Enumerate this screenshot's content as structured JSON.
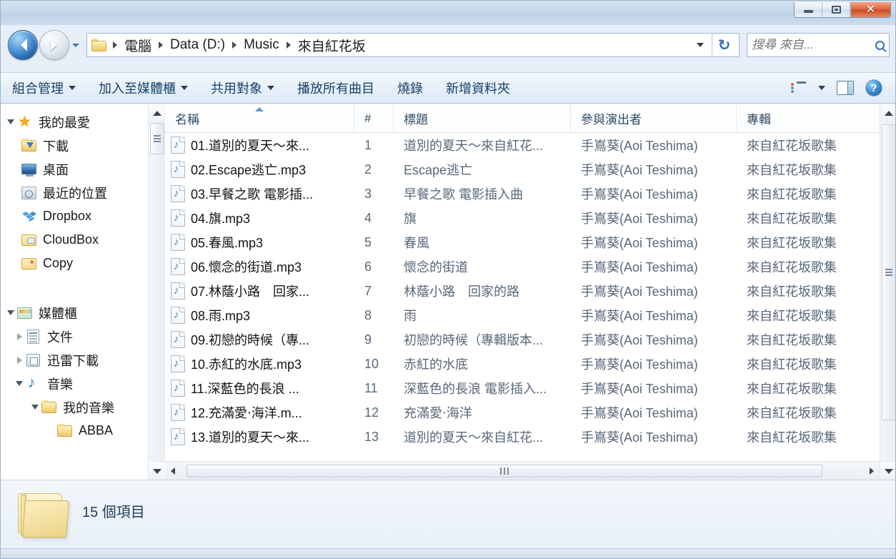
{
  "window": {
    "buttons": {
      "minimize": "minimize",
      "restore": "restore",
      "close": "✕"
    }
  },
  "address": {
    "back_label": "上一頁",
    "forward_label": "下一頁",
    "history_label": "最近的位置",
    "crumbs": [
      "電腦",
      "Data (D:)",
      "Music",
      "來自紅花坂"
    ],
    "dropdown_label": "▼",
    "refresh_label": "重新整理",
    "refresh_glyph": "↻"
  },
  "search": {
    "placeholder": "搜尋 來自...",
    "value": "",
    "icon": "search-icon"
  },
  "toolbar": {
    "items": [
      {
        "label": "組合管理",
        "caret": true
      },
      {
        "label": "加入至媒體櫃",
        "caret": true
      },
      {
        "label": "共用對象",
        "caret": true
      },
      {
        "label": "播放所有曲目",
        "caret": false
      },
      {
        "label": "燒錄",
        "caret": false
      },
      {
        "label": "新增資料夾",
        "caret": false
      }
    ],
    "view_options_icon": "view-list-icon",
    "view_caret": "▼",
    "preview_pane_icon": "preview-pane-icon",
    "help_icon": "help-icon",
    "help_glyph": "?"
  },
  "sidebar": {
    "groups": [
      {
        "label": "我的最愛",
        "icon": "star-icon",
        "expander": "open",
        "items": [
          {
            "label": "下載",
            "icon": "folder-download-icon"
          },
          {
            "label": "桌面",
            "icon": "desktop-icon"
          },
          {
            "label": "最近的位置",
            "icon": "recent-places-icon"
          },
          {
            "label": "Dropbox",
            "icon": "dropbox-icon"
          },
          {
            "label": "CloudBox",
            "icon": "cloudbox-folder-icon"
          },
          {
            "label": "Copy",
            "icon": "copy-folder-icon"
          }
        ]
      },
      {
        "label": "媒體櫃",
        "icon": "library-icon",
        "expander": "open",
        "items": [
          {
            "label": "文件",
            "icon": "documents-icon",
            "expander": "closed",
            "indent": 1
          },
          {
            "label": "迅雷下載",
            "icon": "thunder-download-icon",
            "expander": "closed",
            "indent": 1
          },
          {
            "label": "音樂",
            "icon": "music-note-icon",
            "expander": "open",
            "indent": 1
          },
          {
            "label": "我的音樂",
            "icon": "folder-icon",
            "expander": "open",
            "indent": 2
          },
          {
            "label": "ABBA",
            "icon": "folder-icon",
            "expander": "none",
            "indent": 3
          }
        ]
      }
    ]
  },
  "columns": [
    {
      "key": "name",
      "label": "名稱",
      "sorted": "asc"
    },
    {
      "key": "num",
      "label": "#",
      "sorted": ""
    },
    {
      "key": "title",
      "label": "標題",
      "sorted": ""
    },
    {
      "key": "artist",
      "label": "參與演出者",
      "sorted": ""
    },
    {
      "key": "album",
      "label": "專輯",
      "sorted": ""
    }
  ],
  "files": [
    {
      "name": "01.道別的夏天～來...",
      "num": "1",
      "title": "道別的夏天～來自紅花...",
      "artist": "手嶌葵(Aoi Teshima)",
      "album": "來自紅花坂歌集"
    },
    {
      "name": "02.Escape逃亡.mp3",
      "num": "2",
      "title": "Escape逃亡",
      "artist": "手嶌葵(Aoi Teshima)",
      "album": "來自紅花坂歌集"
    },
    {
      "name": "03.早餐之歌 電影插...",
      "num": "3",
      "title": "早餐之歌 電影插入曲",
      "artist": "手嶌葵(Aoi Teshima)",
      "album": "來自紅花坂歌集"
    },
    {
      "name": "04.旗.mp3",
      "num": "4",
      "title": "旗",
      "artist": "手嶌葵(Aoi Teshima)",
      "album": "來自紅花坂歌集"
    },
    {
      "name": "05.春風.mp3",
      "num": "5",
      "title": "春風",
      "artist": "手嶌葵(Aoi Teshima)",
      "album": "來自紅花坂歌集"
    },
    {
      "name": "06.懷念的街道.mp3",
      "num": "6",
      "title": "懷念的街道",
      "artist": "手嶌葵(Aoi Teshima)",
      "album": "來自紅花坂歌集"
    },
    {
      "name": "07.林蔭小路　回家...",
      "num": "7",
      "title": "林蔭小路　回家的路",
      "artist": "手嶌葵(Aoi Teshima)",
      "album": "來自紅花坂歌集"
    },
    {
      "name": "08.雨.mp3",
      "num": "8",
      "title": "雨",
      "artist": "手嶌葵(Aoi Teshima)",
      "album": "來自紅花坂歌集"
    },
    {
      "name": "09.初戀的時候（專...",
      "num": "9",
      "title": "初戀的時候（專輯版本...",
      "artist": "手嶌葵(Aoi Teshima)",
      "album": "來自紅花坂歌集"
    },
    {
      "name": "10.赤紅的水底.mp3",
      "num": "10",
      "title": "赤紅的水底",
      "artist": "手嶌葵(Aoi Teshima)",
      "album": "來自紅花坂歌集"
    },
    {
      "name": "11.深藍色的長浪 ...",
      "num": "11",
      "title": "深藍色的長浪 電影插入...",
      "artist": "手嶌葵(Aoi Teshima)",
      "album": "來自紅花坂歌集"
    },
    {
      "name": "12.充滿愛‧海洋.m...",
      "num": "12",
      "title": "充滿愛‧海洋",
      "artist": "手嶌葵(Aoi Teshima)",
      "album": "來自紅花坂歌集"
    },
    {
      "name": "13.道別的夏天～來...",
      "num": "13",
      "title": "道別的夏天～來自紅花...",
      "artist": "手嶌葵(Aoi Teshima)",
      "album": "來自紅花坂歌集"
    }
  ],
  "status": {
    "item_count_text": "15 個項目",
    "folder_icon": "open-folder-icon"
  },
  "colors": {
    "accent": "#2f6fb5",
    "close_button": "#cf4c23",
    "sort_arrow": "#5b9bd5",
    "crumb_text": "#1d1d1d",
    "secondary_text": "#58687a"
  }
}
